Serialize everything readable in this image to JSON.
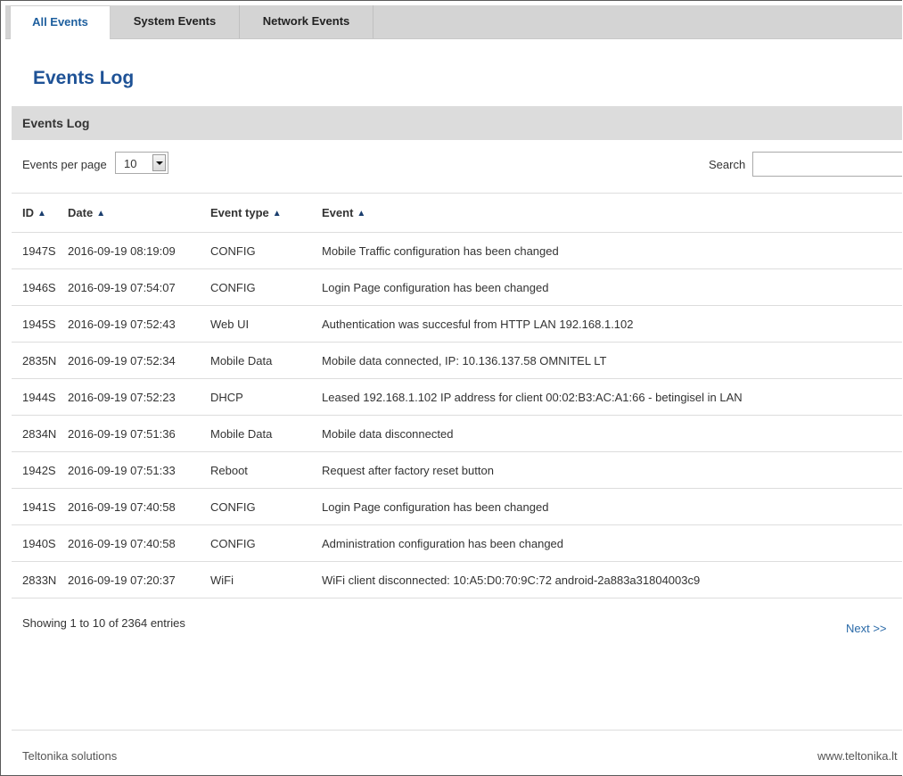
{
  "tabs": [
    {
      "label": "All Events",
      "active": true
    },
    {
      "label": "System Events",
      "active": false
    },
    {
      "label": "Network Events",
      "active": false
    }
  ],
  "page": {
    "title": "Events Log",
    "section_title": "Events Log"
  },
  "controls": {
    "events_per_page_label": "Events per page",
    "events_per_page_value": "10",
    "search_label": "Search",
    "search_value": ""
  },
  "table": {
    "columns": [
      "ID",
      "Date",
      "Event type",
      "Event"
    ],
    "rows": [
      [
        "1947S",
        "2016-09-19 08:19:09",
        "CONFIG",
        "Mobile Traffic configuration has been changed"
      ],
      [
        "1946S",
        "2016-09-19 07:54:07",
        "CONFIG",
        "Login Page configuration has been changed"
      ],
      [
        "1945S",
        "2016-09-19 07:52:43",
        "Web UI",
        "Authentication was succesful from HTTP LAN 192.168.1.102"
      ],
      [
        "2835N",
        "2016-09-19 07:52:34",
        "Mobile Data",
        "Mobile data connected, IP: 10.136.137.58 OMNITEL LT"
      ],
      [
        "1944S",
        "2016-09-19 07:52:23",
        "DHCP",
        "Leased 192.168.1.102 IP address for client 00:02:B3:AC:A1:66 - betingisel in LAN"
      ],
      [
        "2834N",
        "2016-09-19 07:51:36",
        "Mobile Data",
        "Mobile data disconnected"
      ],
      [
        "1942S",
        "2016-09-19 07:51:33",
        "Reboot",
        "Request after factory reset button"
      ],
      [
        "1941S",
        "2016-09-19 07:40:58",
        "CONFIG",
        "Login Page configuration has been changed"
      ],
      [
        "1940S",
        "2016-09-19 07:40:58",
        "CONFIG",
        "Administration configuration has been changed"
      ],
      [
        "2833N",
        "2016-09-19 07:20:37",
        "WiFi",
        "WiFi client disconnected: 10:A5:D0:70:9C:72 android-2a883a31804003c9"
      ]
    ]
  },
  "pagination": {
    "showing_text": "Showing 1 to 10 of 2364 entries",
    "next_label": "Next >>"
  },
  "footer": {
    "left": "Teltonika solutions",
    "right": "www.teltonika.lt"
  }
}
